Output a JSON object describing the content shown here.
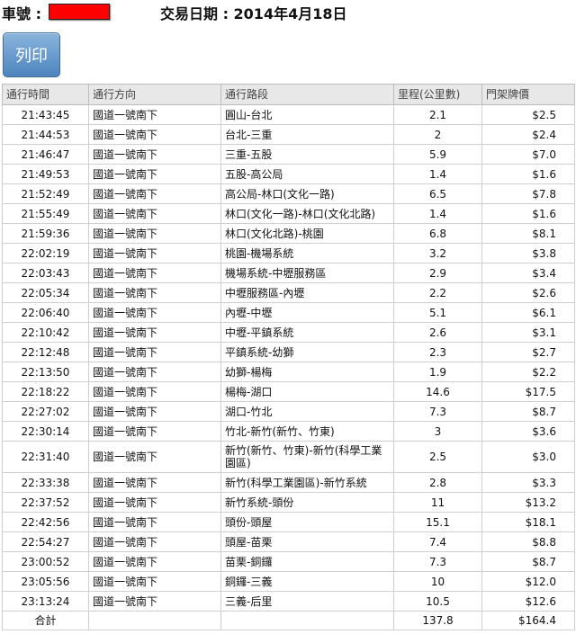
{
  "header": {
    "plate_label": "車號 :",
    "date_label": "交易日期 : 2014年4月18日"
  },
  "print_button": {
    "label": "列印"
  },
  "table": {
    "columns": [
      "通行時間",
      "通行方向",
      "通行路段",
      "里程(公里數)",
      "門架牌價"
    ],
    "rows": [
      {
        "time": "21:43:45",
        "direction": "國道一號南下",
        "segment": "圓山-台北",
        "km": "2.1",
        "price": "$2.5"
      },
      {
        "time": "21:44:53",
        "direction": "國道一號南下",
        "segment": "台北-三重",
        "km": "2",
        "price": "$2.4"
      },
      {
        "time": "21:46:47",
        "direction": "國道一號南下",
        "segment": "三重-五股",
        "km": "5.9",
        "price": "$7.0"
      },
      {
        "time": "21:49:53",
        "direction": "國道一號南下",
        "segment": "五股-高公局",
        "km": "1.4",
        "price": "$1.6"
      },
      {
        "time": "21:52:49",
        "direction": "國道一號南下",
        "segment": "高公局-林口(文化一路)",
        "km": "6.5",
        "price": "$7.8"
      },
      {
        "time": "21:55:49",
        "direction": "國道一號南下",
        "segment": "林口(文化一路)-林口(文化北路)",
        "km": "1.4",
        "price": "$1.6"
      },
      {
        "time": "21:59:36",
        "direction": "國道一號南下",
        "segment": "林口(文化北路)-桃園",
        "km": "6.8",
        "price": "$8.1"
      },
      {
        "time": "22:02:19",
        "direction": "國道一號南下",
        "segment": "桃園-機場系統",
        "km": "3.2",
        "price": "$3.8"
      },
      {
        "time": "22:03:43",
        "direction": "國道一號南下",
        "segment": "機場系統-中壢服務區",
        "km": "2.9",
        "price": "$3.4"
      },
      {
        "time": "22:05:34",
        "direction": "國道一號南下",
        "segment": "中壢服務區-內壢",
        "km": "2.2",
        "price": "$2.6"
      },
      {
        "time": "22:06:40",
        "direction": "國道一號南下",
        "segment": "內壢-中壢",
        "km": "5.1",
        "price": "$6.1"
      },
      {
        "time": "22:10:42",
        "direction": "國道一號南下",
        "segment": "中壢-平鎮系統",
        "km": "2.6",
        "price": "$3.1"
      },
      {
        "time": "22:12:48",
        "direction": "國道一號南下",
        "segment": "平鎮系統-幼獅",
        "km": "2.3",
        "price": "$2.7"
      },
      {
        "time": "22:13:50",
        "direction": "國道一號南下",
        "segment": "幼獅-楊梅",
        "km": "1.9",
        "price": "$2.2"
      },
      {
        "time": "22:18:22",
        "direction": "國道一號南下",
        "segment": "楊梅-湖口",
        "km": "14.6",
        "price": "$17.5"
      },
      {
        "time": "22:27:02",
        "direction": "國道一號南下",
        "segment": "湖口-竹北",
        "km": "7.3",
        "price": "$8.7"
      },
      {
        "time": "22:30:14",
        "direction": "國道一號南下",
        "segment": "竹北-新竹(新竹、竹東)",
        "km": "3",
        "price": "$3.6"
      },
      {
        "time": "22:31:40",
        "direction": "國道一號南下",
        "segment": "新竹(新竹、竹東)-新竹(科學工業園區)",
        "km": "2.5",
        "price": "$3.0",
        "tall": true
      },
      {
        "time": "22:33:38",
        "direction": "國道一號南下",
        "segment": "新竹(科學工業園區)-新竹系統",
        "km": "2.8",
        "price": "$3.3"
      },
      {
        "time": "22:37:52",
        "direction": "國道一號南下",
        "segment": "新竹系統-頭份",
        "km": "11",
        "price": "$13.2"
      },
      {
        "time": "22:42:56",
        "direction": "國道一號南下",
        "segment": "頭份-頭屋",
        "km": "15.1",
        "price": "$18.1"
      },
      {
        "time": "22:54:27",
        "direction": "國道一號南下",
        "segment": "頭屋-苗栗",
        "km": "7.4",
        "price": "$8.8"
      },
      {
        "time": "23:00:52",
        "direction": "國道一號南下",
        "segment": "苗栗-銅鑼",
        "km": "7.3",
        "price": "$8.7"
      },
      {
        "time": "23:05:56",
        "direction": "國道一號南下",
        "segment": "銅鑼-三義",
        "km": "10",
        "price": "$12.0"
      },
      {
        "time": "23:13:24",
        "direction": "國道一號南下",
        "segment": "三義-后里",
        "km": "10.5",
        "price": "$12.6"
      }
    ],
    "total": {
      "label": "合計",
      "km": "137.8",
      "price": "$164.4"
    }
  }
}
